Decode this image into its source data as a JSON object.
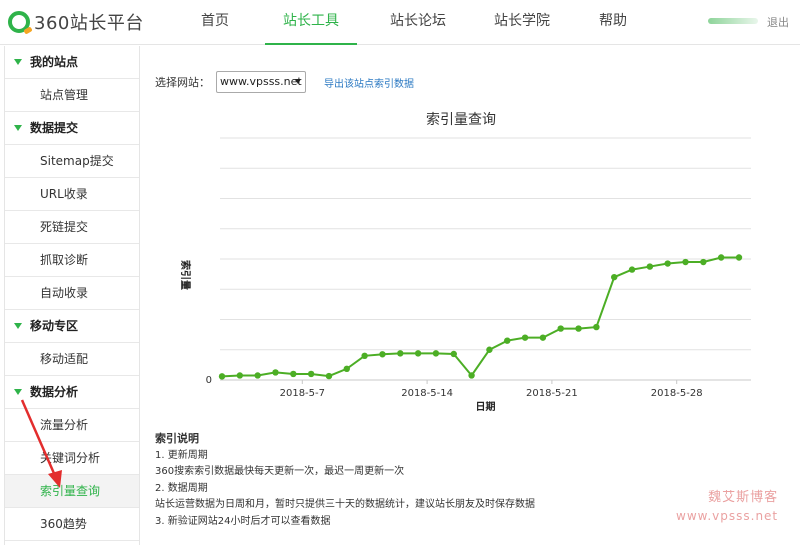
{
  "header": {
    "logo_text": "360站长平台",
    "nav": [
      "首页",
      "站长工具",
      "站长论坛",
      "站长学院",
      "帮助"
    ],
    "active_nav": 1,
    "logout": "退出"
  },
  "sidebar": {
    "groups": [
      {
        "label": "我的站点",
        "items": [
          "站点管理"
        ]
      },
      {
        "label": "数据提交",
        "items": [
          "Sitemap提交",
          "URL收录",
          "死链提交",
          "抓取诊断",
          "自动收录"
        ]
      },
      {
        "label": "移动专区",
        "items": [
          "移动适配"
        ]
      },
      {
        "label": "数据分析",
        "items": [
          "流量分析",
          "关键词分析",
          "索引量查询",
          "360趋势"
        ]
      }
    ],
    "active_item": "索引量查询"
  },
  "toolbar": {
    "site_label": "选择网站：",
    "site_value": "www.vpsss.net",
    "export_label": "导出该站点索引数据"
  },
  "chart_data": {
    "type": "line",
    "title": "索引量查询",
    "xlabel": "日期",
    "ylabel": "索引量",
    "x_tick_labels": [
      "2018-5-7",
      "2018-5-14",
      "2018-5-21",
      "2018-5-28"
    ],
    "y_tick_labels": [
      "0"
    ],
    "grid": true,
    "color": "#4cae25",
    "values": [
      1.2,
      1.5,
      1.5,
      2.5,
      2.0,
      2.0,
      1.3,
      3.7,
      8.0,
      8.5,
      8.8,
      8.8,
      8.8,
      8.6,
      1.5,
      10.0,
      13.0,
      14.0,
      14.0,
      17.0,
      17.0,
      17.5,
      34.0,
      36.5,
      37.5,
      38.5,
      39.0,
      39.0,
      40.5,
      40.5
    ],
    "ylim": [
      0,
      80
    ]
  },
  "notes": {
    "title": "索引说明",
    "lines": [
      "1. 更新周期",
      "360搜索索引数据最快每天更新一次，最迟一周更新一次",
      "2. 数据周期",
      "站长运营数据为日周和月，暂时只提供三十天的数据统计，建议站长朋友及时保存数据",
      "3. 新验证网站24小时后才可以查看数据"
    ]
  },
  "watermark": {
    "line1": "魏艾斯博客",
    "line2": "www.vpsss.net"
  }
}
